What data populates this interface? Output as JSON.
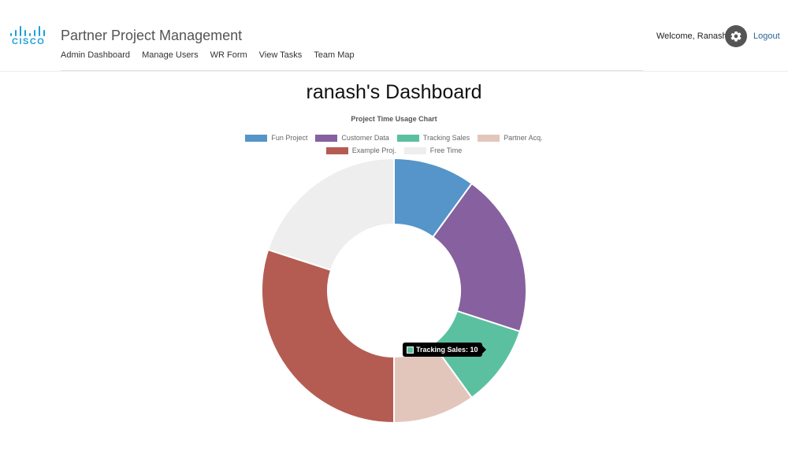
{
  "brand": {
    "logo_text": "CISCO",
    "color": "#1ba0d7"
  },
  "header": {
    "title": "Partner Project Management",
    "nav": [
      "Admin Dashboard",
      "Manage Users",
      "WR Form",
      "View Tasks",
      "Team Map"
    ],
    "welcome": "Welcome, Ranash!",
    "settings_icon": "gear-icon",
    "logout": "Logout"
  },
  "dashboard": {
    "title": "ranash's Dashboard"
  },
  "tooltip": {
    "text": "Tracking Sales: 10",
    "color": "#5bc0a0"
  },
  "chart_data": {
    "type": "pie",
    "title": "Project Time Usage Chart",
    "categories": [
      "Fun Project",
      "Customer Data",
      "Tracking Sales",
      "Partner Acq.",
      "Example Proj.",
      "Free Time"
    ],
    "values": [
      10,
      20,
      10,
      10,
      30,
      20
    ],
    "colors": [
      "#5595c9",
      "#87609f",
      "#5bc0a0",
      "#e3c6bb",
      "#b55c52",
      "#eeeeee"
    ],
    "legend_position": "top",
    "donut": true
  }
}
